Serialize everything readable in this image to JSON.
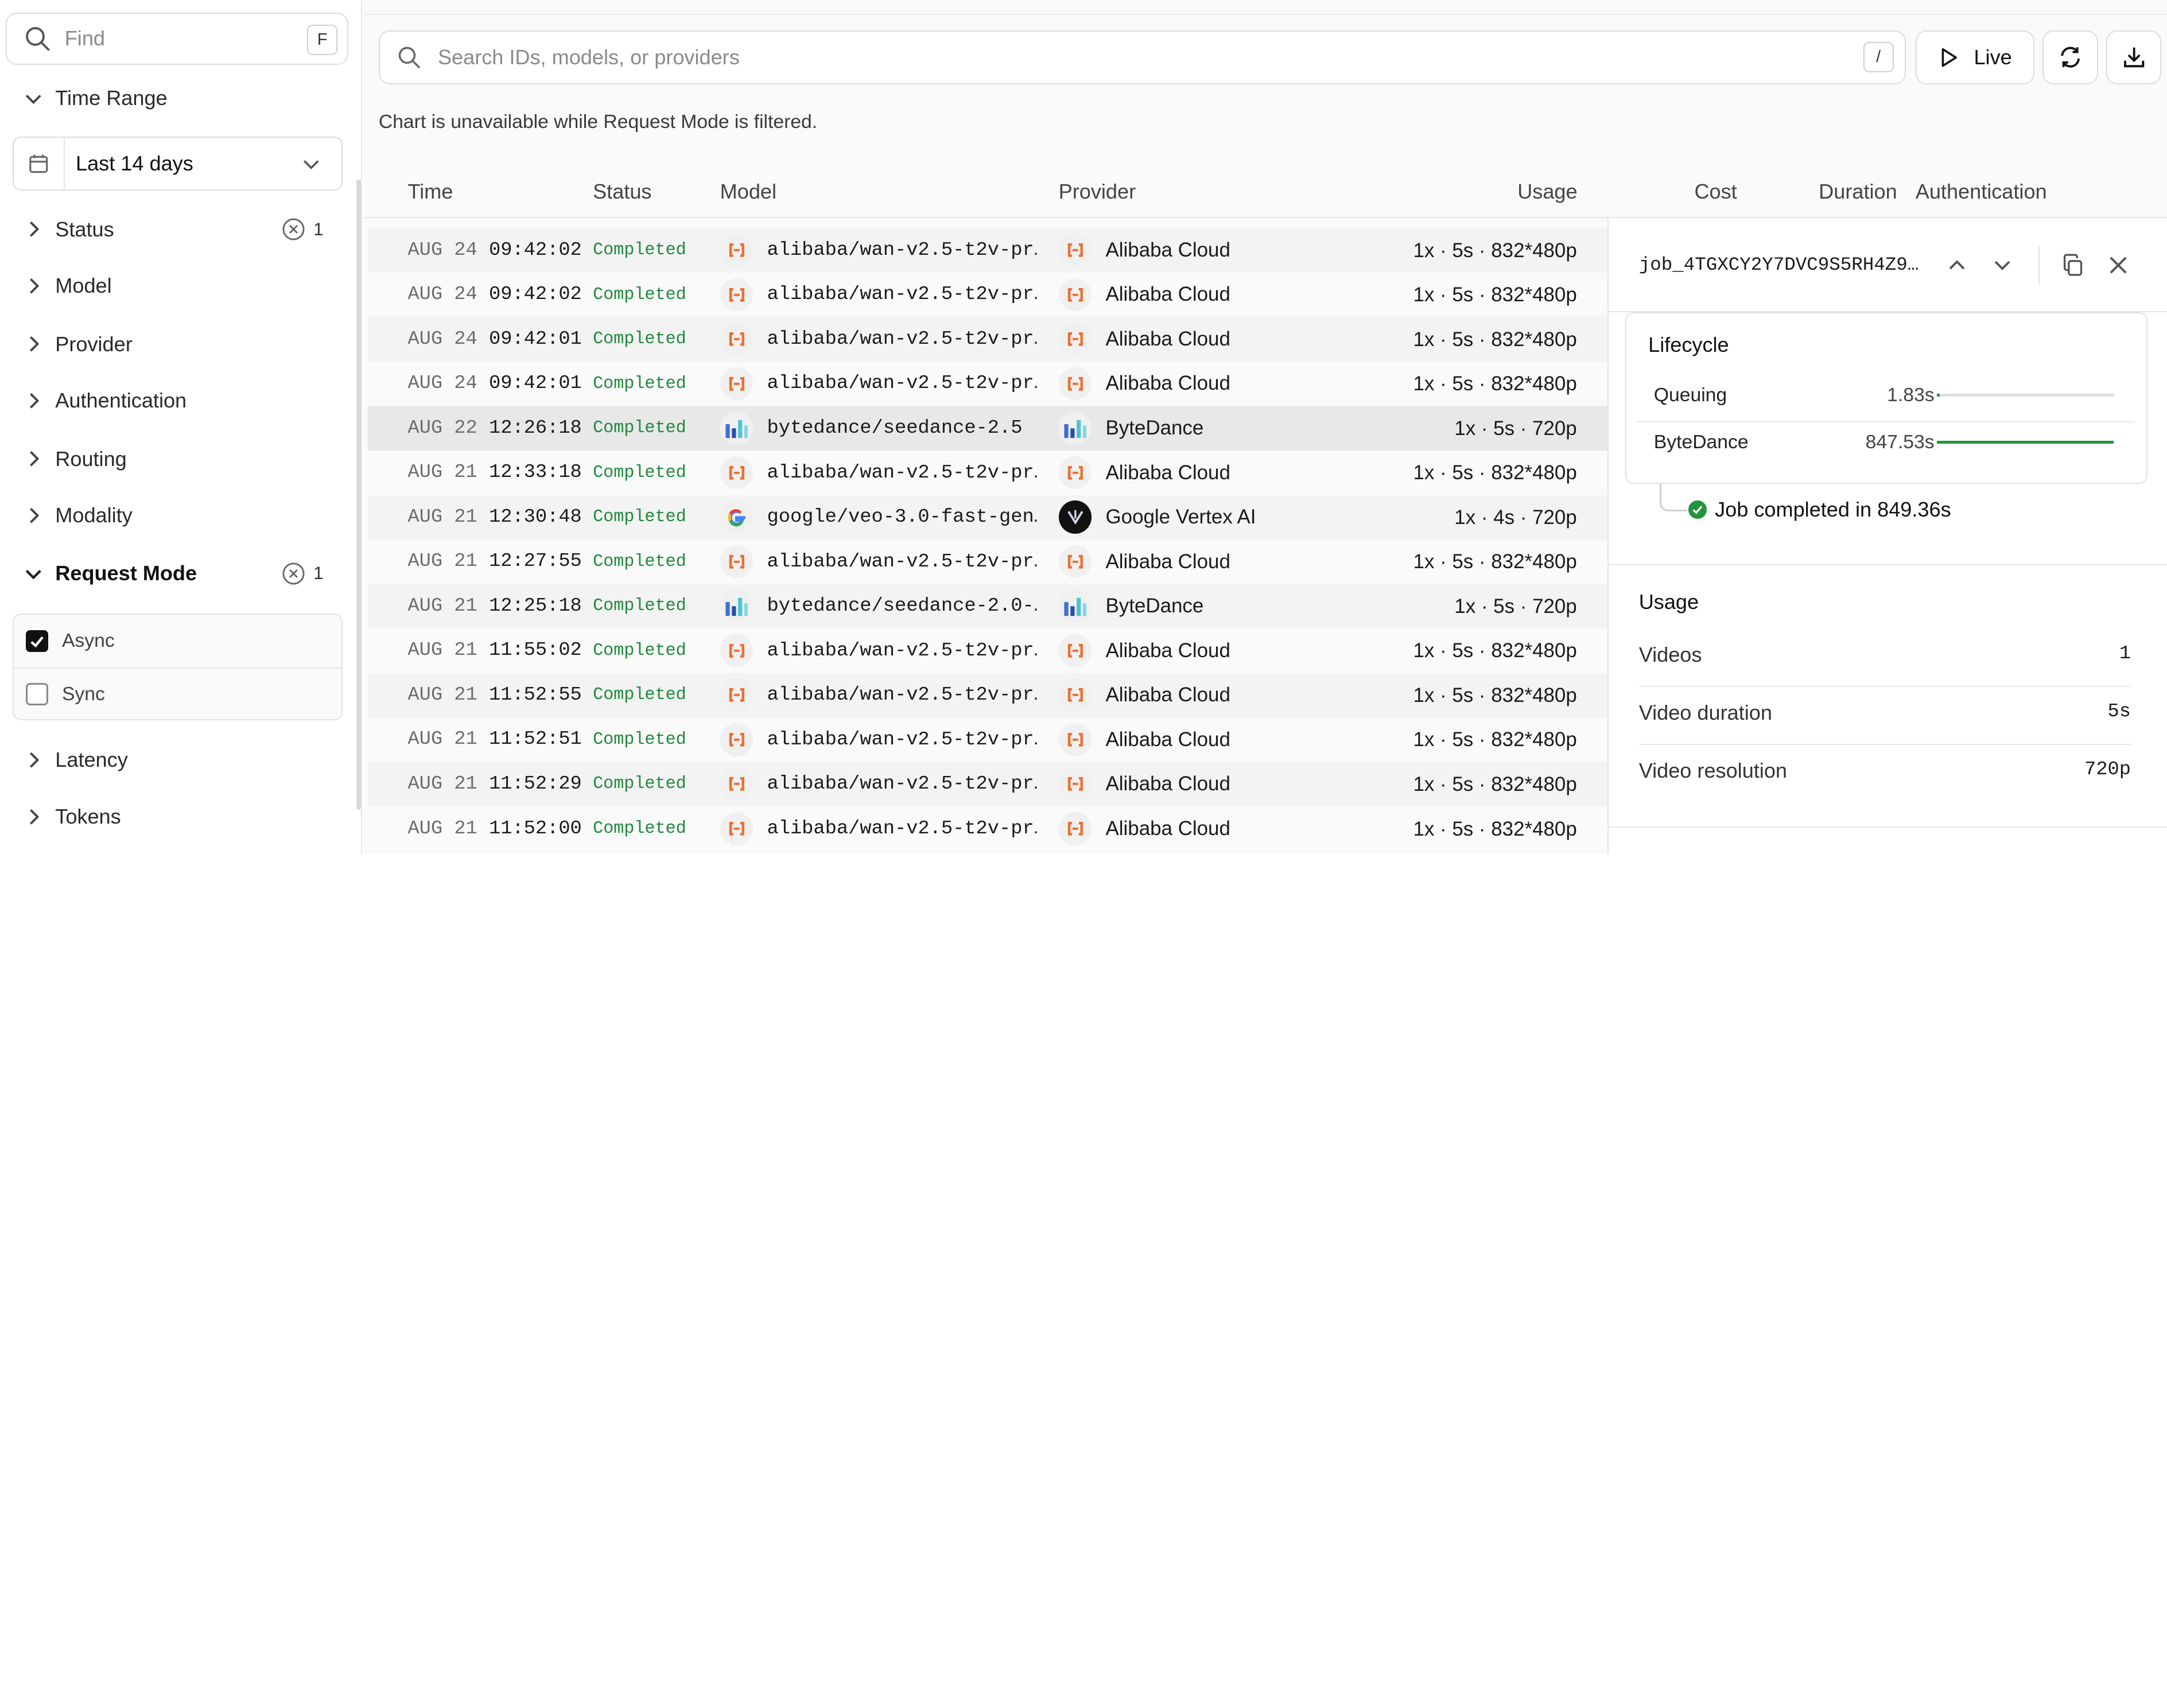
{
  "sidebar": {
    "find_placeholder": "Find",
    "find_shortcut": "F",
    "time_range_label": "Time Range",
    "time_range_value": "Last 14 days",
    "sections": {
      "status": {
        "label": "Status",
        "filter_count": "1"
      },
      "model": {
        "label": "Model"
      },
      "provider": {
        "label": "Provider"
      },
      "authentication": {
        "label": "Authentication"
      },
      "routing": {
        "label": "Routing"
      },
      "modality": {
        "label": "Modality"
      },
      "request_mode": {
        "label": "Request Mode",
        "filter_count": "1"
      },
      "latency": {
        "label": "Latency"
      },
      "tokens": {
        "label": "Tokens"
      }
    },
    "request_mode_options": [
      {
        "label": "Async",
        "checked": true
      },
      {
        "label": "Sync",
        "checked": false
      }
    ]
  },
  "toolbar": {
    "search_placeholder": "Search IDs, models, or providers",
    "search_shortcut": "/",
    "live_label": "Live"
  },
  "notice": "Chart is unavailable while Request Mode is filtered.",
  "table": {
    "columns": [
      "Time",
      "Status",
      "Model",
      "Provider",
      "Usage",
      "Cost",
      "Duration",
      "Authentication"
    ],
    "rows": [
      {
        "date": "AUG 24",
        "time": "09:42:02",
        "status": "Completed",
        "model": "alibaba/wan-v2.5-t2v-pr…",
        "model_icon": "alibaba-logo-icon",
        "provider": "Alibaba Cloud",
        "provider_icon": "alibaba-logo-icon",
        "usage": "1x · 5s · 832*480p"
      },
      {
        "date": "AUG 24",
        "time": "09:42:02",
        "status": "Completed",
        "model": "alibaba/wan-v2.5-t2v-pr…",
        "model_icon": "alibaba-logo-icon",
        "provider": "Alibaba Cloud",
        "provider_icon": "alibaba-logo-icon",
        "usage": "1x · 5s · 832*480p"
      },
      {
        "date": "AUG 24",
        "time": "09:42:01",
        "status": "Completed",
        "model": "alibaba/wan-v2.5-t2v-pr…",
        "model_icon": "alibaba-logo-icon",
        "provider": "Alibaba Cloud",
        "provider_icon": "alibaba-logo-icon",
        "usage": "1x · 5s · 832*480p"
      },
      {
        "date": "AUG 24",
        "time": "09:42:01",
        "status": "Completed",
        "model": "alibaba/wan-v2.5-t2v-pr…",
        "model_icon": "alibaba-logo-icon",
        "provider": "Alibaba Cloud",
        "provider_icon": "alibaba-logo-icon",
        "usage": "1x · 5s · 832*480p"
      },
      {
        "date": "AUG 22",
        "time": "12:26:18",
        "status": "Completed",
        "model": "bytedance/seedance-2.5",
        "model_icon": "bytedance-logo-icon",
        "provider": "ByteDance",
        "provider_icon": "bytedance-logo-icon",
        "usage": "1x · 5s · 720p",
        "selected": true
      },
      {
        "date": "AUG 21",
        "time": "12:33:18",
        "status": "Completed",
        "model": "alibaba/wan-v2.5-t2v-pr…",
        "model_icon": "alibaba-logo-icon",
        "provider": "Alibaba Cloud",
        "provider_icon": "alibaba-logo-icon",
        "usage": "1x · 5s · 832*480p"
      },
      {
        "date": "AUG 21",
        "time": "12:30:48",
        "status": "Completed",
        "model": "google/veo-3.0-fast-gen…",
        "model_icon": "google-logo-icon",
        "provider": "Google Vertex AI",
        "provider_icon": "vertex-ai-logo-icon",
        "usage": "1x · 4s · 720p"
      },
      {
        "date": "AUG 21",
        "time": "12:27:55",
        "status": "Completed",
        "model": "alibaba/wan-v2.5-t2v-pr…",
        "model_icon": "alibaba-logo-icon",
        "provider": "Alibaba Cloud",
        "provider_icon": "alibaba-logo-icon",
        "usage": "1x · 5s · 832*480p"
      },
      {
        "date": "AUG 21",
        "time": "12:25:18",
        "status": "Completed",
        "model": "bytedance/seedance-2.0-…",
        "model_icon": "bytedance-logo-icon",
        "provider": "ByteDance",
        "provider_icon": "bytedance-logo-icon",
        "usage": "1x · 5s · 720p"
      },
      {
        "date": "AUG 21",
        "time": "11:55:02",
        "status": "Completed",
        "model": "alibaba/wan-v2.5-t2v-pr…",
        "model_icon": "alibaba-logo-icon",
        "provider": "Alibaba Cloud",
        "provider_icon": "alibaba-logo-icon",
        "usage": "1x · 5s · 832*480p"
      },
      {
        "date": "AUG 21",
        "time": "11:52:55",
        "status": "Completed",
        "model": "alibaba/wan-v2.5-t2v-pr…",
        "model_icon": "alibaba-logo-icon",
        "provider": "Alibaba Cloud",
        "provider_icon": "alibaba-logo-icon",
        "usage": "1x · 5s · 832*480p"
      },
      {
        "date": "AUG 21",
        "time": "11:52:51",
        "status": "Completed",
        "model": "alibaba/wan-v2.5-t2v-pr…",
        "model_icon": "alibaba-logo-icon",
        "provider": "Alibaba Cloud",
        "provider_icon": "alibaba-logo-icon",
        "usage": "1x · 5s · 832*480p"
      },
      {
        "date": "AUG 21",
        "time": "11:52:29",
        "status": "Completed",
        "model": "alibaba/wan-v2.5-t2v-pr…",
        "model_icon": "alibaba-logo-icon",
        "provider": "Alibaba Cloud",
        "provider_icon": "alibaba-logo-icon",
        "usage": "1x · 5s · 832*480p"
      },
      {
        "date": "AUG 21",
        "time": "11:52:00",
        "status": "Completed",
        "model": "alibaba/wan-v2.5-t2v-pr…",
        "model_icon": "alibaba-logo-icon",
        "provider": "Alibaba Cloud",
        "provider_icon": "alibaba-logo-icon",
        "usage": "1x · 5s · 832*480p"
      }
    ]
  },
  "detail": {
    "job_id": "job_4TGXCY2Y7DVC9S5RH4Z9…",
    "lifecycle": {
      "title": "Lifecycle",
      "stages": [
        {
          "name": "Queuing",
          "value": "1.83s",
          "fraction": 0.0022
        },
        {
          "name": "ByteDance",
          "value": "847.53s",
          "fraction": 0.9978
        }
      ],
      "completed": "Job completed in 849.36s"
    },
    "usage": {
      "title": "Usage",
      "rows": [
        {
          "key": "Videos",
          "value": "1"
        },
        {
          "key": "Video duration",
          "value": "5s"
        },
        {
          "key": "Video resolution",
          "value": "720p"
        }
      ]
    }
  },
  "colors": {
    "status_green": "#1f8a3c",
    "progress_green": "#22943e",
    "alibaba_orange": "#ef6c2c",
    "bytedance_blue": "#3c6fd8"
  }
}
